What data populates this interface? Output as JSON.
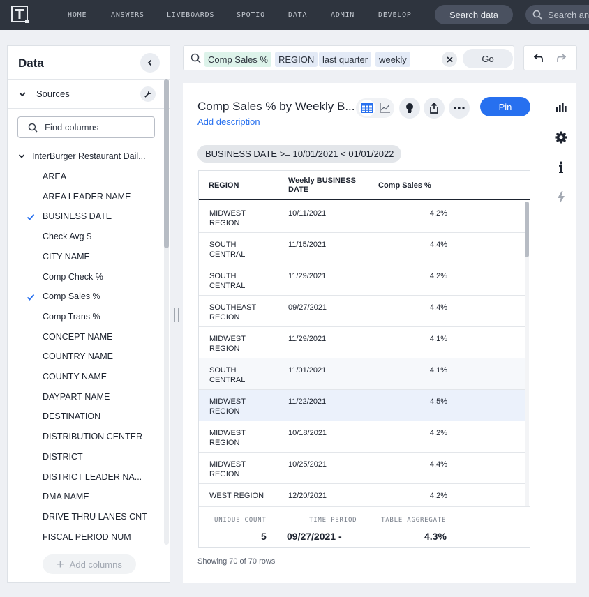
{
  "topnav": {
    "items": [
      "HOME",
      "ANSWERS",
      "LIVEBOARDS",
      "SPOTIQ",
      "DATA",
      "ADMIN",
      "DEVELOP"
    ],
    "search_data_label": "Search data",
    "search_answers_placeholder": "Search ans"
  },
  "data_panel": {
    "title": "Data",
    "sources_label": "Sources",
    "find_placeholder": "Find columns",
    "source_name": "InterBurger Restaurant Dail...",
    "columns": [
      {
        "label": "AREA",
        "checked": false
      },
      {
        "label": "AREA LEADER NAME",
        "checked": false
      },
      {
        "label": "BUSINESS DATE",
        "checked": true
      },
      {
        "label": "Check Avg $",
        "checked": false
      },
      {
        "label": "CITY NAME",
        "checked": false
      },
      {
        "label": "Comp Check %",
        "checked": false
      },
      {
        "label": "Comp Sales %",
        "checked": true
      },
      {
        "label": "Comp Trans %",
        "checked": false
      },
      {
        "label": "CONCEPT NAME",
        "checked": false
      },
      {
        "label": "COUNTRY NAME",
        "checked": false
      },
      {
        "label": "COUNTY NAME",
        "checked": false
      },
      {
        "label": "DAYPART NAME",
        "checked": false
      },
      {
        "label": "DESTINATION",
        "checked": false
      },
      {
        "label": "DISTRIBUTION CENTER",
        "checked": false
      },
      {
        "label": "DISTRICT",
        "checked": false
      },
      {
        "label": "DISTRICT LEADER NA...",
        "checked": false
      },
      {
        "label": "DMA NAME",
        "checked": false
      },
      {
        "label": "DRIVE THRU LANES CNT",
        "checked": false
      },
      {
        "label": "FISCAL PERIOD NUM",
        "checked": false
      }
    ],
    "add_columns_label": "Add columns"
  },
  "searchbar": {
    "tokens": [
      "Comp Sales %",
      "REGION",
      "last quarter",
      "weekly"
    ],
    "go_label": "Go"
  },
  "answer": {
    "title": "Comp Sales % by Weekly B...",
    "add_description": "Add description",
    "pin_label": "Pin",
    "filter_chip": "BUSINESS DATE >= 10/01/2021 < 01/01/2022",
    "columns": [
      "REGION",
      "Weekly BUSINESS DATE",
      "Comp Sales %"
    ],
    "rows": [
      {
        "region": "MIDWEST REGION",
        "date": "10/11/2021",
        "value": "4.2%"
      },
      {
        "region": "SOUTH CENTRAL",
        "date": "11/15/2021",
        "value": "4.4%"
      },
      {
        "region": "SOUTH CENTRAL",
        "date": "11/29/2021",
        "value": "4.2%"
      },
      {
        "region": "SOUTHEAST REGION",
        "date": "09/27/2021",
        "value": "4.4%"
      },
      {
        "region": "MIDWEST REGION",
        "date": "11/29/2021",
        "value": "4.1%"
      },
      {
        "region": "SOUTH CENTRAL",
        "date": "11/01/2021",
        "value": "4.1%"
      },
      {
        "region": "MIDWEST REGION",
        "date": "11/22/2021",
        "value": "4.5%"
      },
      {
        "region": "MIDWEST REGION",
        "date": "10/18/2021",
        "value": "4.2%"
      },
      {
        "region": "MIDWEST REGION",
        "date": "10/25/2021",
        "value": "4.4%"
      },
      {
        "region": "WEST REGION",
        "date": "12/20/2021",
        "value": "4.2%"
      }
    ],
    "footer": {
      "unique_count_label": "UNIQUE COUNT",
      "unique_count_value": "5",
      "time_period_label": "TIME PERIOD",
      "time_period_value": "09/27/2021 -",
      "table_aggregate_label": "TABLE AGGREGATE",
      "table_aggregate_value": "4.3%"
    },
    "showing": "Showing 70 of 70 rows"
  },
  "colors": {
    "nav_bg": "#2e343e",
    "accent_blue": "#2770ef",
    "check_blue": "#2770ef",
    "token_green": "#ddf3ea",
    "token_blue": "#e3eaf6"
  },
  "rail_icons": [
    "bar-chart-icon",
    "gear-icon",
    "info-icon",
    "lightning-icon"
  ]
}
